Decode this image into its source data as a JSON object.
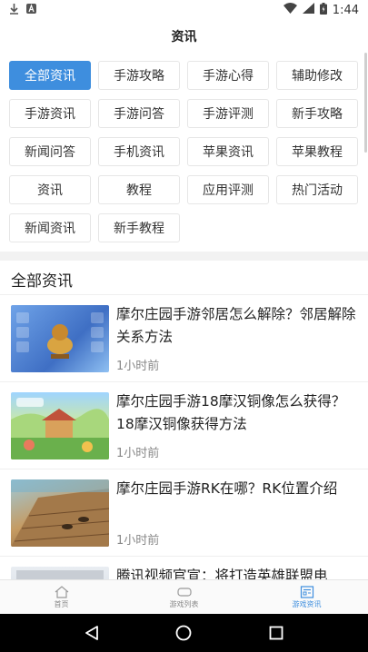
{
  "status_bar": {
    "time": "1:44",
    "left_icons": [
      "download-icon",
      "app-a-icon"
    ],
    "right_icons": [
      "wifi-icon",
      "signal-icon",
      "battery-icon"
    ]
  },
  "header": {
    "title": "资讯"
  },
  "tags": [
    {
      "label": "全部资讯",
      "active": true
    },
    {
      "label": "手游攻略",
      "active": false
    },
    {
      "label": "手游心得",
      "active": false
    },
    {
      "label": "辅助修改",
      "active": false
    },
    {
      "label": "手游资讯",
      "active": false
    },
    {
      "label": "手游问答",
      "active": false
    },
    {
      "label": "手游评测",
      "active": false
    },
    {
      "label": "新手攻略",
      "active": false
    },
    {
      "label": "新闻问答",
      "active": false
    },
    {
      "label": "手机资讯",
      "active": false
    },
    {
      "label": "苹果资讯",
      "active": false
    },
    {
      "label": "苹果教程",
      "active": false
    },
    {
      "label": "资讯",
      "active": false
    },
    {
      "label": "教程",
      "active": false
    },
    {
      "label": "应用评测",
      "active": false
    },
    {
      "label": "热门活动",
      "active": false
    },
    {
      "label": "新闻资讯",
      "active": false
    },
    {
      "label": "新手教程",
      "active": false
    }
  ],
  "section": {
    "title": "全部资讯"
  },
  "news": [
    {
      "title": "摩尔庄园手游邻居怎么解除？邻居解除关系方法",
      "time": "1小时前"
    },
    {
      "title": "摩尔庄园手游18摩汉铜像怎么获得？18摩汉铜像获得方法",
      "time": "1小时前"
    },
    {
      "title": "摩尔庄园手游RK在哪？RK位置介绍",
      "time": "1小时前"
    },
    {
      "title": "腾讯视频官宣：将打造英雄联盟电",
      "time": ""
    }
  ],
  "tabbar": {
    "items": [
      {
        "label": "首页",
        "icon": "home-icon",
        "active": false
      },
      {
        "label": "游戏列表",
        "icon": "game-controller-icon",
        "active": false
      },
      {
        "label": "游戏资讯",
        "icon": "news-icon",
        "active": true
      }
    ]
  },
  "colors": {
    "accent": "#3e8ede",
    "tag_border": "#e6e6e6",
    "muted_text": "#888888"
  }
}
